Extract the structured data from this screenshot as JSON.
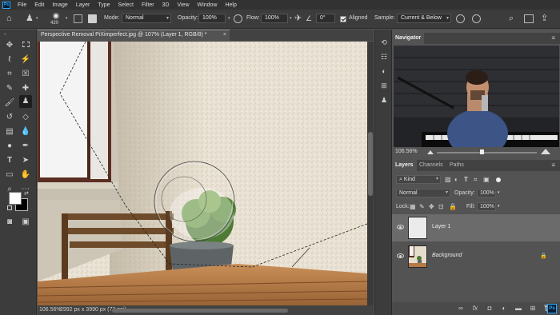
{
  "app": {
    "logo": "Ps"
  },
  "menu": [
    "File",
    "Edit",
    "Image",
    "Layer",
    "Type",
    "Select",
    "Filter",
    "3D",
    "View",
    "Window",
    "Help"
  ],
  "options": {
    "brush_size": "420",
    "mode_label": "Mode:",
    "mode_value": "Normal",
    "opacity_label": "Opacity:",
    "opacity_value": "100%",
    "flow_label": "Flow:",
    "flow_value": "100%",
    "angle_value": "0°",
    "aligned_label": "Aligned",
    "sample_label": "Sample:",
    "sample_value": "Current & Below"
  },
  "document": {
    "tab_title": "Perspective Removal PiXimperfect.jpg @ 107% (Layer 1, RGB/8) *",
    "close": "×",
    "zoom": "106.56%",
    "info": "2992 px x 3990 px (72 ppi)"
  },
  "navigator": {
    "tab": "Navigator",
    "zoom": "106.56%"
  },
  "layers": {
    "tabs": [
      "Layers",
      "Channels",
      "Paths"
    ],
    "kind_label": "Kind",
    "blend_mode": "Normal",
    "opacity_label": "Opacity:",
    "opacity_value": "100%",
    "lock_label": "Lock:",
    "fill_label": "Fill:",
    "fill_value": "100%",
    "items": [
      {
        "name": "Layer 1",
        "selected": true
      },
      {
        "name": "Background",
        "selected": false,
        "locked": true
      }
    ]
  },
  "colors": {
    "accent": "#31a8ff",
    "panel_bg": "#535353",
    "chrome_bg": "#3c3c3c",
    "foreground_swatch": "#ffffff",
    "background_swatch": "#000000"
  },
  "icons": {
    "toolbar": [
      "move-tool-icon",
      "marquee-icon",
      "lasso-icon",
      "magic-wand-icon",
      "crop-icon",
      "frame-icon",
      "eyedropper-icon",
      "healing-icon",
      "brush-icon",
      "clone-stamp-icon",
      "history-brush-icon",
      "eraser-icon",
      "gradient-icon",
      "blur-icon",
      "dodge-icon",
      "pen-icon",
      "type-icon",
      "path-select-icon",
      "rectangle-icon",
      "hand-icon",
      "zoom-icon",
      "more-icon"
    ]
  }
}
